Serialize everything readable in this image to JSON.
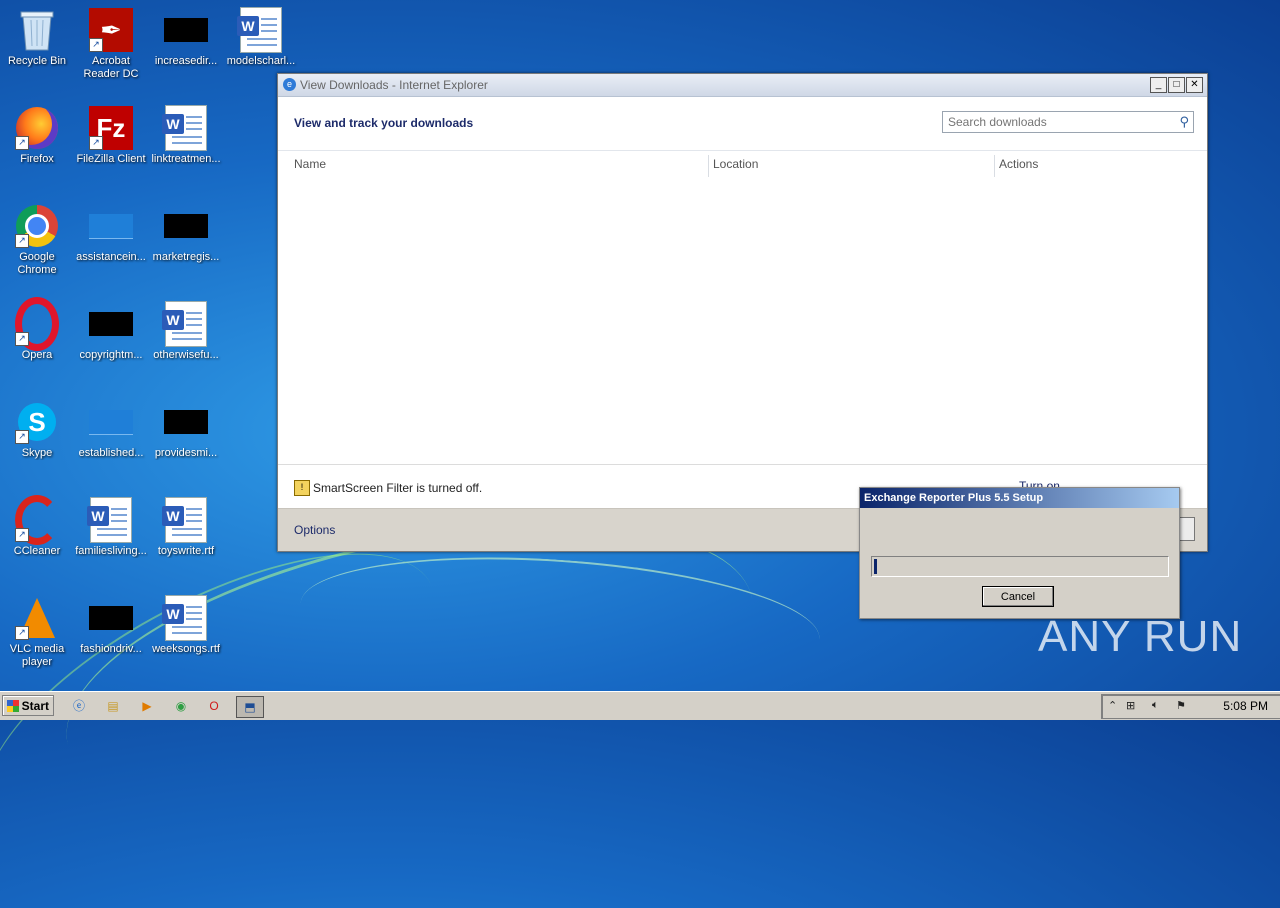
{
  "desktop": {
    "icons": [
      {
        "label": "Recycle Bin"
      },
      {
        "label": "Acrobat Reader DC"
      },
      {
        "label": "increasedir..."
      },
      {
        "label": "modelscharl..."
      },
      {
        "label": "Firefox"
      },
      {
        "label": "FileZilla Client"
      },
      {
        "label": "linktreatmen..."
      },
      {
        "label": "Google Chrome"
      },
      {
        "label": "assistancein..."
      },
      {
        "label": "marketregis..."
      },
      {
        "label": "Opera"
      },
      {
        "label": "copyrightm..."
      },
      {
        "label": "otherwisefu..."
      },
      {
        "label": "Skype"
      },
      {
        "label": "established..."
      },
      {
        "label": "providesmi..."
      },
      {
        "label": "CCleaner"
      },
      {
        "label": "familiesliving..."
      },
      {
        "label": "toyswrite.rtf"
      },
      {
        "label": "VLC media player"
      },
      {
        "label": "fashiondriv..."
      },
      {
        "label": "weeksongs.rtf"
      }
    ]
  },
  "ie_window": {
    "title": "View Downloads - Internet Explorer",
    "heading": "View and track your downloads",
    "search_placeholder": "Search downloads",
    "columns": [
      "Name",
      "Location",
      "Actions"
    ],
    "smartscreen_text": "SmartScreen Filter is turned off.",
    "turn_on_label": "Turn on",
    "options_label": "Options",
    "buttons": {
      "minimize": "_",
      "maximize": "□",
      "close": "✕"
    }
  },
  "setup_dialog": {
    "title": "Exchange Reporter Plus 5.5 Setup",
    "progress": 0.01,
    "cancel_label": "Cancel"
  },
  "watermark": "ANY RUN",
  "taskbar": {
    "start_label": "Start",
    "clock": "5:08 PM"
  }
}
